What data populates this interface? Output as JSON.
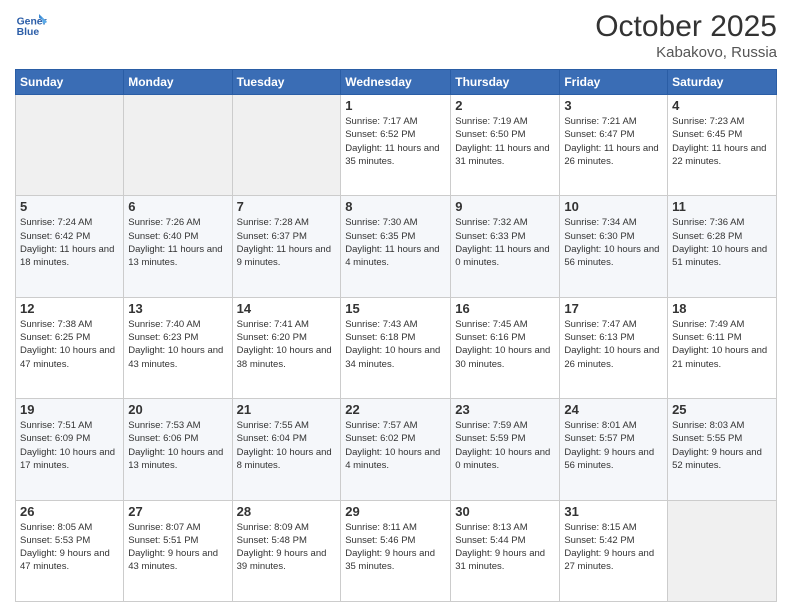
{
  "header": {
    "logo_line1": "General",
    "logo_line2": "Blue",
    "month": "October 2025",
    "location": "Kabakovo, Russia"
  },
  "days_of_week": [
    "Sunday",
    "Monday",
    "Tuesday",
    "Wednesday",
    "Thursday",
    "Friday",
    "Saturday"
  ],
  "weeks": [
    [
      {
        "day": "",
        "sunrise": "",
        "sunset": "",
        "daylight": ""
      },
      {
        "day": "",
        "sunrise": "",
        "sunset": "",
        "daylight": ""
      },
      {
        "day": "",
        "sunrise": "",
        "sunset": "",
        "daylight": ""
      },
      {
        "day": "1",
        "sunrise": "7:17 AM",
        "sunset": "6:52 PM",
        "daylight": "11 hours and 35 minutes."
      },
      {
        "day": "2",
        "sunrise": "7:19 AM",
        "sunset": "6:50 PM",
        "daylight": "11 hours and 31 minutes."
      },
      {
        "day": "3",
        "sunrise": "7:21 AM",
        "sunset": "6:47 PM",
        "daylight": "11 hours and 26 minutes."
      },
      {
        "day": "4",
        "sunrise": "7:23 AM",
        "sunset": "6:45 PM",
        "daylight": "11 hours and 22 minutes."
      }
    ],
    [
      {
        "day": "5",
        "sunrise": "7:24 AM",
        "sunset": "6:42 PM",
        "daylight": "11 hours and 18 minutes."
      },
      {
        "day": "6",
        "sunrise": "7:26 AM",
        "sunset": "6:40 PM",
        "daylight": "11 hours and 13 minutes."
      },
      {
        "day": "7",
        "sunrise": "7:28 AM",
        "sunset": "6:37 PM",
        "daylight": "11 hours and 9 minutes."
      },
      {
        "day": "8",
        "sunrise": "7:30 AM",
        "sunset": "6:35 PM",
        "daylight": "11 hours and 4 minutes."
      },
      {
        "day": "9",
        "sunrise": "7:32 AM",
        "sunset": "6:33 PM",
        "daylight": "11 hours and 0 minutes."
      },
      {
        "day": "10",
        "sunrise": "7:34 AM",
        "sunset": "6:30 PM",
        "daylight": "10 hours and 56 minutes."
      },
      {
        "day": "11",
        "sunrise": "7:36 AM",
        "sunset": "6:28 PM",
        "daylight": "10 hours and 51 minutes."
      }
    ],
    [
      {
        "day": "12",
        "sunrise": "7:38 AM",
        "sunset": "6:25 PM",
        "daylight": "10 hours and 47 minutes."
      },
      {
        "day": "13",
        "sunrise": "7:40 AM",
        "sunset": "6:23 PM",
        "daylight": "10 hours and 43 minutes."
      },
      {
        "day": "14",
        "sunrise": "7:41 AM",
        "sunset": "6:20 PM",
        "daylight": "10 hours and 38 minutes."
      },
      {
        "day": "15",
        "sunrise": "7:43 AM",
        "sunset": "6:18 PM",
        "daylight": "10 hours and 34 minutes."
      },
      {
        "day": "16",
        "sunrise": "7:45 AM",
        "sunset": "6:16 PM",
        "daylight": "10 hours and 30 minutes."
      },
      {
        "day": "17",
        "sunrise": "7:47 AM",
        "sunset": "6:13 PM",
        "daylight": "10 hours and 26 minutes."
      },
      {
        "day": "18",
        "sunrise": "7:49 AM",
        "sunset": "6:11 PM",
        "daylight": "10 hours and 21 minutes."
      }
    ],
    [
      {
        "day": "19",
        "sunrise": "7:51 AM",
        "sunset": "6:09 PM",
        "daylight": "10 hours and 17 minutes."
      },
      {
        "day": "20",
        "sunrise": "7:53 AM",
        "sunset": "6:06 PM",
        "daylight": "10 hours and 13 minutes."
      },
      {
        "day": "21",
        "sunrise": "7:55 AM",
        "sunset": "6:04 PM",
        "daylight": "10 hours and 8 minutes."
      },
      {
        "day": "22",
        "sunrise": "7:57 AM",
        "sunset": "6:02 PM",
        "daylight": "10 hours and 4 minutes."
      },
      {
        "day": "23",
        "sunrise": "7:59 AM",
        "sunset": "5:59 PM",
        "daylight": "10 hours and 0 minutes."
      },
      {
        "day": "24",
        "sunrise": "8:01 AM",
        "sunset": "5:57 PM",
        "daylight": "9 hours and 56 minutes."
      },
      {
        "day": "25",
        "sunrise": "8:03 AM",
        "sunset": "5:55 PM",
        "daylight": "9 hours and 52 minutes."
      }
    ],
    [
      {
        "day": "26",
        "sunrise": "8:05 AM",
        "sunset": "5:53 PM",
        "daylight": "9 hours and 47 minutes."
      },
      {
        "day": "27",
        "sunrise": "8:07 AM",
        "sunset": "5:51 PM",
        "daylight": "9 hours and 43 minutes."
      },
      {
        "day": "28",
        "sunrise": "8:09 AM",
        "sunset": "5:48 PM",
        "daylight": "9 hours and 39 minutes."
      },
      {
        "day": "29",
        "sunrise": "8:11 AM",
        "sunset": "5:46 PM",
        "daylight": "9 hours and 35 minutes."
      },
      {
        "day": "30",
        "sunrise": "8:13 AM",
        "sunset": "5:44 PM",
        "daylight": "9 hours and 31 minutes."
      },
      {
        "day": "31",
        "sunrise": "8:15 AM",
        "sunset": "5:42 PM",
        "daylight": "9 hours and 27 minutes."
      },
      {
        "day": "",
        "sunrise": "",
        "sunset": "",
        "daylight": ""
      }
    ]
  ]
}
